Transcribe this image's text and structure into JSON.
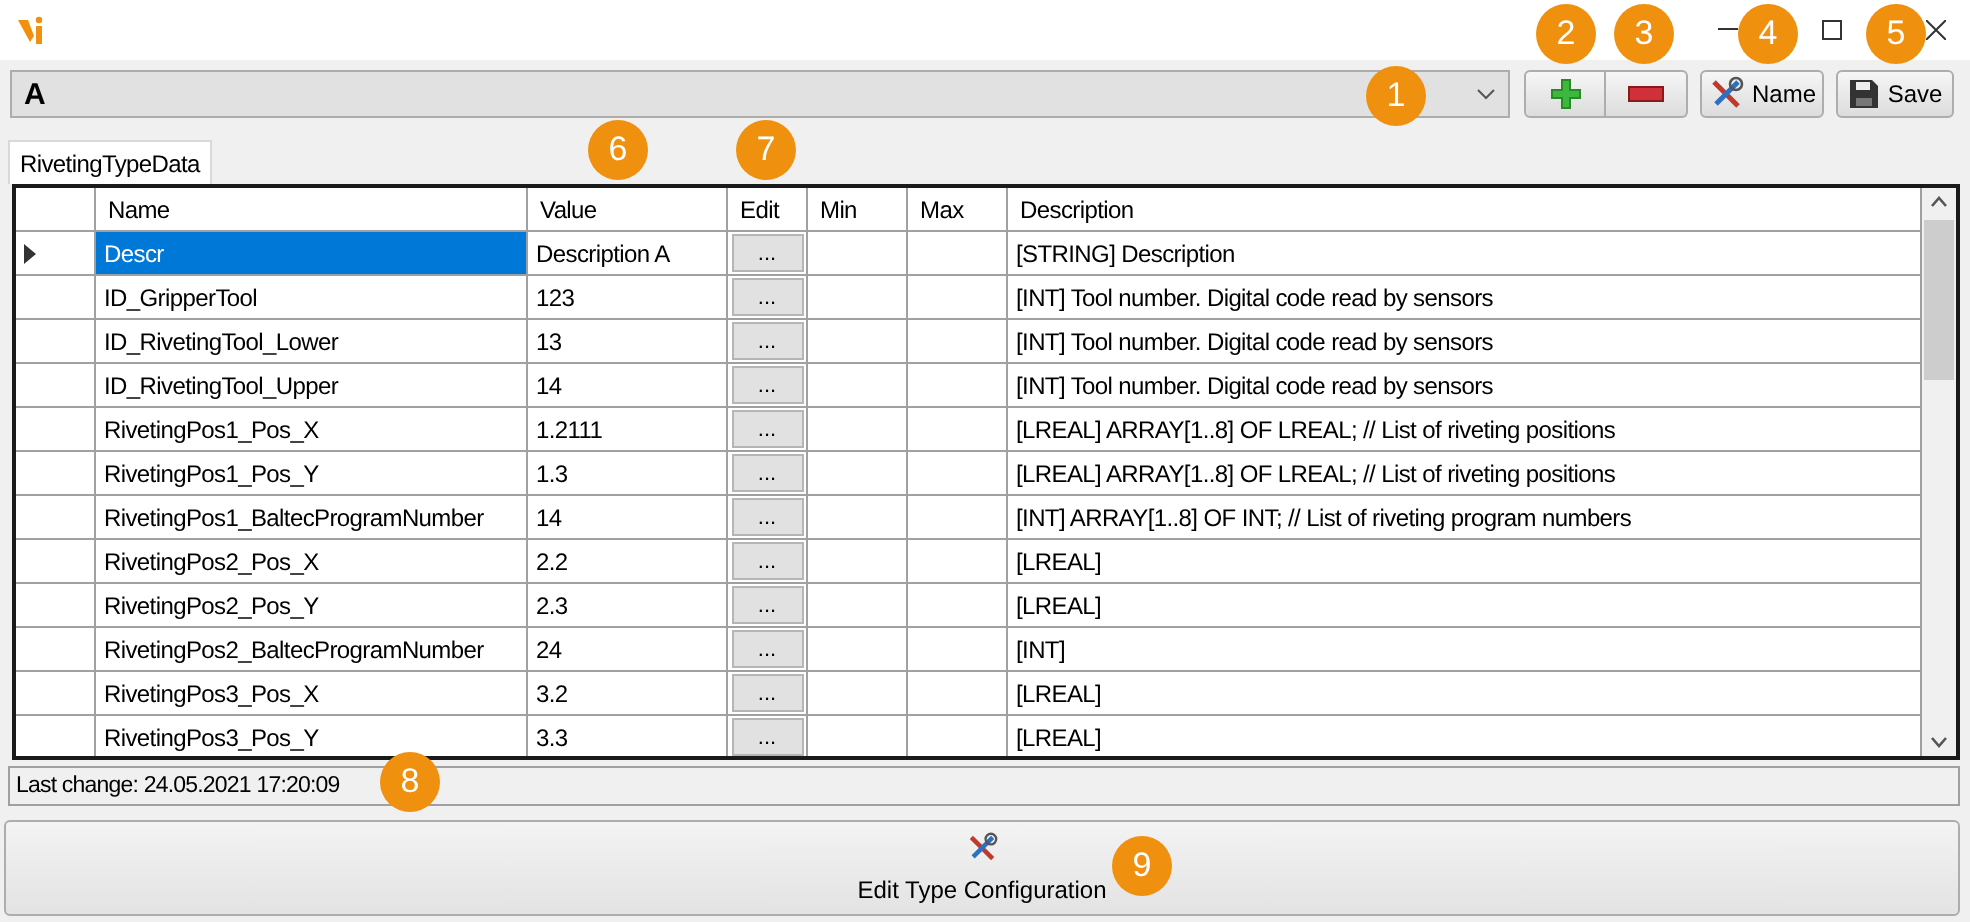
{
  "toolbar": {
    "combo_value": "A",
    "buttons": [
      {
        "kind": "add"
      },
      {
        "kind": "remove"
      },
      {
        "kind": "name",
        "label": "Name"
      },
      {
        "kind": "save",
        "label": "Save"
      }
    ]
  },
  "tabs": [
    {
      "label": "RivetingTypeData",
      "selected": true
    }
  ],
  "table": {
    "columns": [
      "Name",
      "Value",
      "Edit",
      "Min",
      "Max",
      "Description"
    ],
    "rows": [
      {
        "name": "Descr",
        "value": "Description A",
        "edit": "...",
        "description": "[STRING] Description",
        "selected": true
      },
      {
        "name": "ID_GripperTool",
        "value": "123",
        "edit": "...",
        "description": "[INT] Tool number. Digital code read by sensors",
        "selected": false
      },
      {
        "name": "ID_RivetingTool_Lower",
        "value": "13",
        "edit": "...",
        "description": "[INT] Tool number. Digital code read by sensors",
        "selected": false
      },
      {
        "name": "ID_RivetingTool_Upper",
        "value": "14",
        "edit": "...",
        "description": "[INT] Tool number. Digital code read by sensors",
        "selected": false
      },
      {
        "name": "RivetingPos1_Pos_X",
        "value": "1.2111",
        "edit": "...",
        "description": "[LREAL]    ARRAY[1..8] OF LREAL; // List of riveting positions",
        "selected": false
      },
      {
        "name": "RivetingPos1_Pos_Y",
        "value": "1.3",
        "edit": "...",
        "description": "[LREAL]    ARRAY[1..8] OF LREAL; // List of riveting positions",
        "selected": false
      },
      {
        "name": "RivetingPos1_BaltecProgramNumber",
        "value": "14",
        "edit": "...",
        "description": "[INT] ARRAY[1..8] OF INT; // List of riveting program numbers",
        "selected": false
      },
      {
        "name": "RivetingPos2_Pos_X",
        "value": "2.2",
        "edit": "...",
        "description": "[LREAL]",
        "selected": false
      },
      {
        "name": "RivetingPos2_Pos_Y",
        "value": "2.3",
        "edit": "...",
        "description": "[LREAL]",
        "selected": false
      },
      {
        "name": "RivetingPos2_BaltecProgramNumber",
        "value": "24",
        "edit": "...",
        "description": "[INT]",
        "selected": false
      },
      {
        "name": "RivetingPos3_Pos_X",
        "value": "3.2",
        "edit": "...",
        "description": "[LREAL]",
        "selected": false
      },
      {
        "name": "RivetingPos3_Pos_Y",
        "value": "3.3",
        "edit": "...",
        "description": "[LREAL]",
        "selected": false
      }
    ]
  },
  "status_bar": "Last change: 24.05.2021 17:20:09",
  "bottom_button": {
    "label": "Edit Type Configuration"
  },
  "callouts": [
    {
      "label": "1"
    },
    {
      "label": "2"
    },
    {
      "label": "3"
    },
    {
      "label": "4"
    },
    {
      "label": "5"
    },
    {
      "label": "6"
    },
    {
      "label": "7"
    },
    {
      "label": "8"
    },
    {
      "label": "9"
    }
  ]
}
